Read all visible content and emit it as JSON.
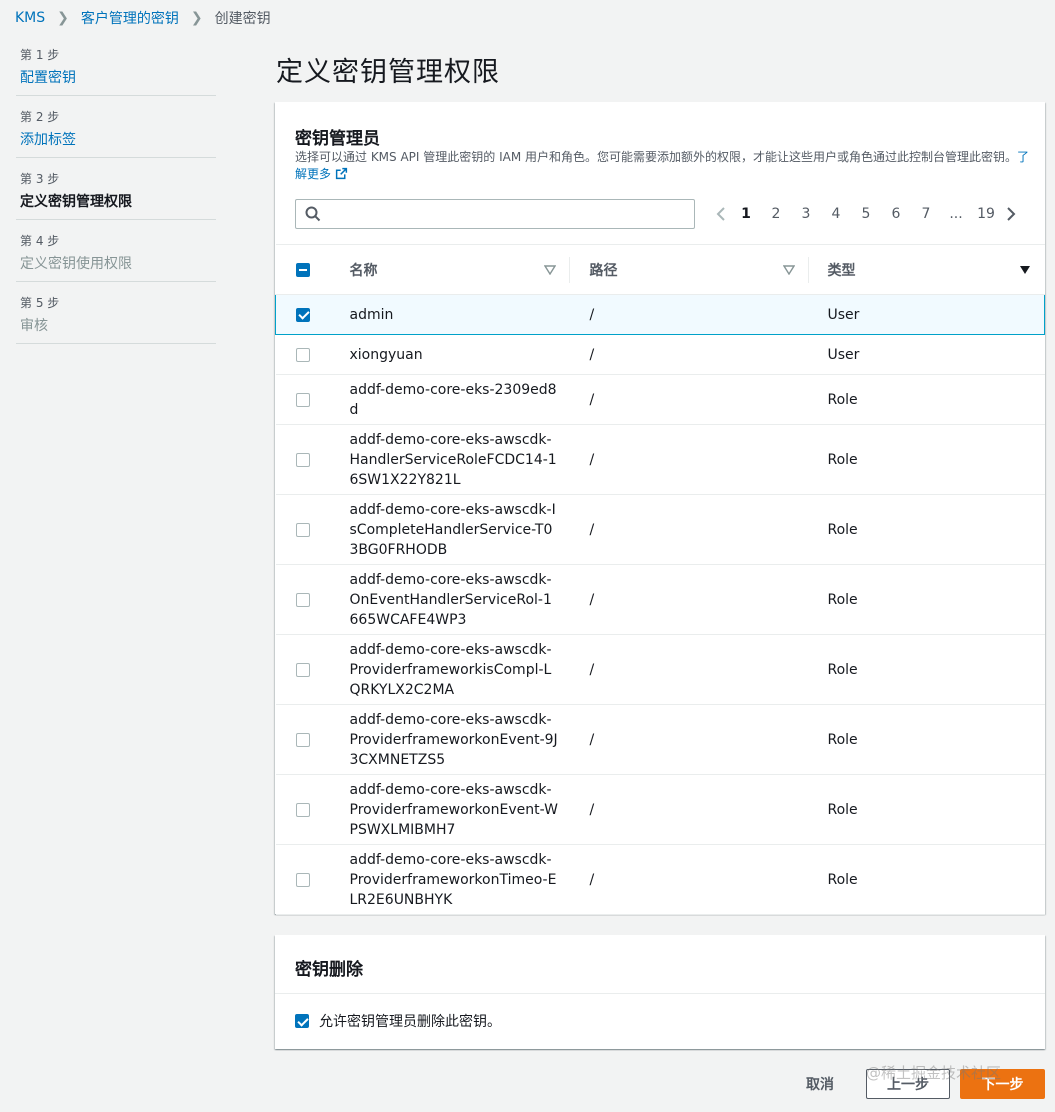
{
  "breadcrumb": {
    "items": [
      "KMS",
      "客户管理的密钥",
      "创建密钥"
    ]
  },
  "steps": [
    {
      "num": "第 1 步",
      "name": "配置密钥",
      "state": "link"
    },
    {
      "num": "第 2 步",
      "name": "添加标签",
      "state": "link"
    },
    {
      "num": "第 3 步",
      "name": "定义密钥管理权限",
      "state": "active"
    },
    {
      "num": "第 4 步",
      "name": "定义密钥使用权限",
      "state": "disabled"
    },
    {
      "num": "第 5 步",
      "name": "审核",
      "state": "disabled"
    }
  ],
  "page_title": "定义密钥管理权限",
  "admins": {
    "title": "密钥管理员",
    "description": "选择可以通过 KMS API 管理此密钥的 IAM 用户和角色。您可能需要添加额外的权限，才能让这些用户或角色通过此控制台管理此密钥。",
    "learn_more": "了解更多",
    "search_placeholder": "",
    "pagination": [
      "1",
      "2",
      "3",
      "4",
      "5",
      "6",
      "7",
      "...",
      "19"
    ],
    "current_page": "1",
    "columns": {
      "name": "名称",
      "path": "路径",
      "type": "类型"
    },
    "rows": [
      {
        "checked": true,
        "name": "admin",
        "path": "/",
        "type": "User"
      },
      {
        "checked": false,
        "name": "xiongyuan",
        "path": "/",
        "type": "User"
      },
      {
        "checked": false,
        "name": "addf-demo-core-eks-2309ed8d",
        "path": "/",
        "type": "Role"
      },
      {
        "checked": false,
        "name": "addf-demo-core-eks-awscdk-HandlerServiceRoleFCDC14-16SW1X22Y821L",
        "path": "/",
        "type": "Role"
      },
      {
        "checked": false,
        "name": "addf-demo-core-eks-awscdk-IsCompleteHandlerService-T03BG0FRHODB",
        "path": "/",
        "type": "Role"
      },
      {
        "checked": false,
        "name": "addf-demo-core-eks-awscdk-OnEventHandlerServiceRol-1665WCAFE4WP3",
        "path": "/",
        "type": "Role"
      },
      {
        "checked": false,
        "name": "addf-demo-core-eks-awscdk-ProviderframeworkisCompl-LQRKYLX2C2MA",
        "path": "/",
        "type": "Role"
      },
      {
        "checked": false,
        "name": "addf-demo-core-eks-awscdk-ProviderframeworkonEvent-9J3CXMNETZS5",
        "path": "/",
        "type": "Role"
      },
      {
        "checked": false,
        "name": "addf-demo-core-eks-awscdk-ProviderframeworkonEvent-WPSWXLMIBMH7",
        "path": "/",
        "type": "Role"
      },
      {
        "checked": false,
        "name": "addf-demo-core-eks-awscdk-ProviderframeworkonTimeo-ELR2E6UNBHYK",
        "path": "/",
        "type": "Role"
      }
    ]
  },
  "deletion": {
    "title": "密钥删除",
    "allow_label": "允许密钥管理员删除此密钥。",
    "allow_checked": true
  },
  "footer": {
    "cancel": "取消",
    "previous": "上一步",
    "next": "下一步"
  },
  "watermark": "@稀土掘金技术社区",
  "colors": {
    "link": "#0073bb",
    "primary": "#ec7211",
    "selected_row_bg": "#f1faff",
    "selected_row_border": "#00a1c9"
  }
}
